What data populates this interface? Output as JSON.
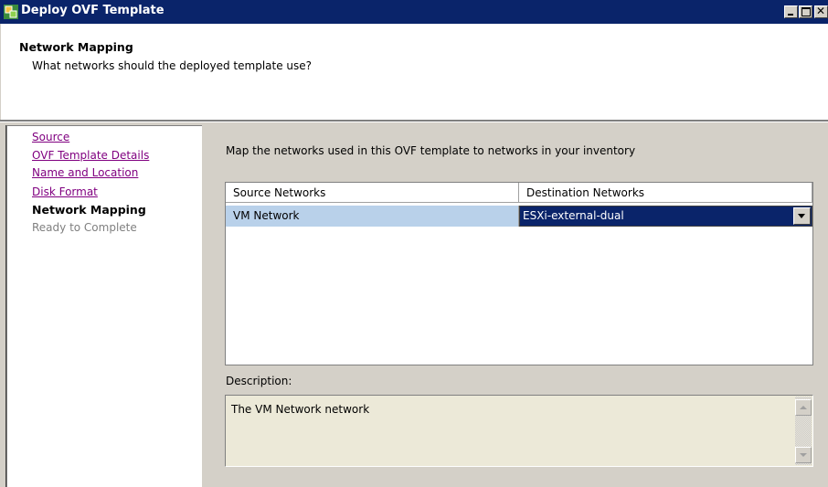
{
  "window": {
    "title": "Deploy OVF Template",
    "icon": "vsphere-app-icon",
    "controls": [
      "minimize-icon",
      "maximize-icon",
      "close-icon"
    ],
    "accent_color": "#0a246a"
  },
  "header": {
    "title": "Network Mapping",
    "subtitle": "What networks should the deployed template use?"
  },
  "steps": [
    {
      "label": "Source",
      "state": "done"
    },
    {
      "label": "OVF Template Details",
      "state": "done"
    },
    {
      "label": "Name and Location",
      "state": "done"
    },
    {
      "label": "Disk Format",
      "state": "done"
    },
    {
      "label": "Network Mapping",
      "state": "current"
    },
    {
      "label": "Ready to Complete",
      "state": "pending"
    }
  ],
  "main": {
    "instruction": "Map the networks used in this OVF template to networks in your inventory",
    "table": {
      "columns": [
        "Source Networks",
        "Destination Networks"
      ],
      "rows": [
        {
          "source": "VM Network",
          "destination": "ESXi-external-dual"
        }
      ]
    },
    "description_label": "Description:",
    "description_text": "The VM Network network"
  }
}
